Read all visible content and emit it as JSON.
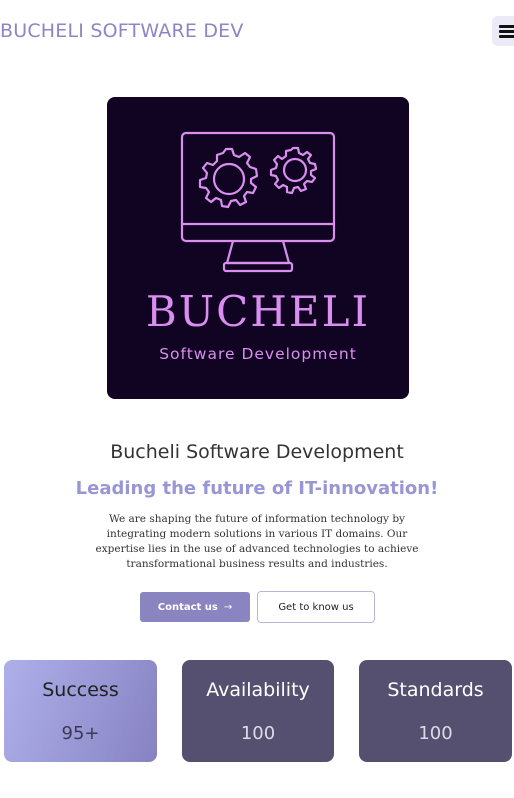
{
  "header": {
    "brand": "BUCHELI SOFTWARE DEV",
    "menu_icon": "hamburger-menu-icon"
  },
  "logo": {
    "wordmark": "BUCHELI",
    "subtitle": "Software Development",
    "icon": "monitor-gears-icon",
    "colors": {
      "background": "#110322",
      "accent": "#d98ef0"
    }
  },
  "hero": {
    "title": "Bucheli Software Development",
    "tagline": "Leading the future of IT-innovation!",
    "description": "We are shaping the future of information technology by integrating modern solutions in various IT domains. Our expertise lies in the use of advanced technologies to achieve transformational business results and industries."
  },
  "actions": {
    "contact_label": "Contact us",
    "contact_icon": "arrow-right-icon",
    "about_label": "Get to know us"
  },
  "stats": [
    {
      "label": "Success",
      "value": "95+"
    },
    {
      "label": "Availability",
      "value": "100"
    },
    {
      "label": "Standards",
      "value": "100"
    }
  ],
  "colors": {
    "brand": "#8a87c4",
    "tagline": "#9896d4",
    "primary_button": "#8a84c0",
    "stat_dark": "#55506f"
  }
}
